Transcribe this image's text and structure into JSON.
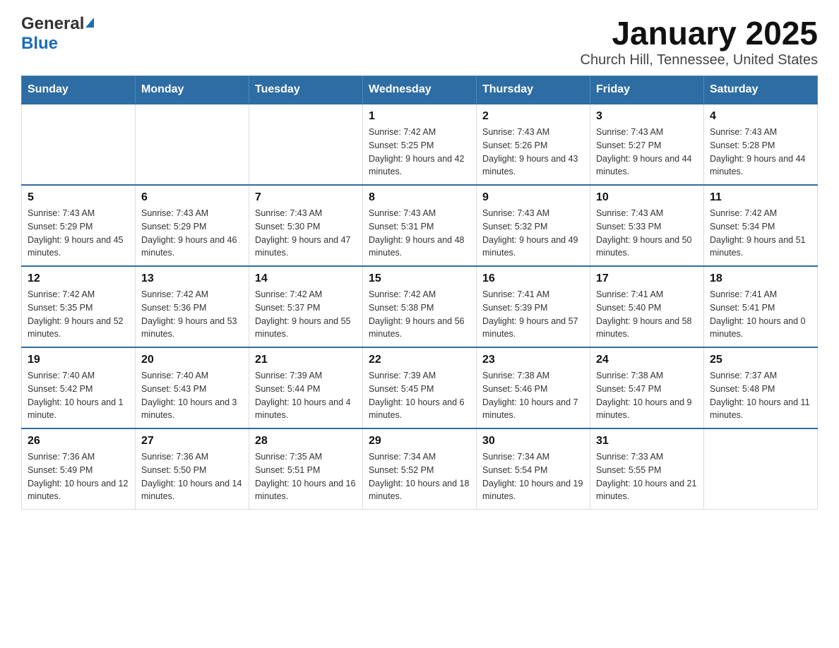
{
  "header": {
    "logo_general": "General",
    "logo_blue": "Blue",
    "title": "January 2025",
    "subtitle": "Church Hill, Tennessee, United States"
  },
  "days_of_week": [
    "Sunday",
    "Monday",
    "Tuesday",
    "Wednesday",
    "Thursday",
    "Friday",
    "Saturday"
  ],
  "weeks": [
    [
      {
        "day": "",
        "info": ""
      },
      {
        "day": "",
        "info": ""
      },
      {
        "day": "",
        "info": ""
      },
      {
        "day": "1",
        "info": "Sunrise: 7:42 AM\nSunset: 5:25 PM\nDaylight: 9 hours and 42 minutes."
      },
      {
        "day": "2",
        "info": "Sunrise: 7:43 AM\nSunset: 5:26 PM\nDaylight: 9 hours and 43 minutes."
      },
      {
        "day": "3",
        "info": "Sunrise: 7:43 AM\nSunset: 5:27 PM\nDaylight: 9 hours and 44 minutes."
      },
      {
        "day": "4",
        "info": "Sunrise: 7:43 AM\nSunset: 5:28 PM\nDaylight: 9 hours and 44 minutes."
      }
    ],
    [
      {
        "day": "5",
        "info": "Sunrise: 7:43 AM\nSunset: 5:29 PM\nDaylight: 9 hours and 45 minutes."
      },
      {
        "day": "6",
        "info": "Sunrise: 7:43 AM\nSunset: 5:29 PM\nDaylight: 9 hours and 46 minutes."
      },
      {
        "day": "7",
        "info": "Sunrise: 7:43 AM\nSunset: 5:30 PM\nDaylight: 9 hours and 47 minutes."
      },
      {
        "day": "8",
        "info": "Sunrise: 7:43 AM\nSunset: 5:31 PM\nDaylight: 9 hours and 48 minutes."
      },
      {
        "day": "9",
        "info": "Sunrise: 7:43 AM\nSunset: 5:32 PM\nDaylight: 9 hours and 49 minutes."
      },
      {
        "day": "10",
        "info": "Sunrise: 7:43 AM\nSunset: 5:33 PM\nDaylight: 9 hours and 50 minutes."
      },
      {
        "day": "11",
        "info": "Sunrise: 7:42 AM\nSunset: 5:34 PM\nDaylight: 9 hours and 51 minutes."
      }
    ],
    [
      {
        "day": "12",
        "info": "Sunrise: 7:42 AM\nSunset: 5:35 PM\nDaylight: 9 hours and 52 minutes."
      },
      {
        "day": "13",
        "info": "Sunrise: 7:42 AM\nSunset: 5:36 PM\nDaylight: 9 hours and 53 minutes."
      },
      {
        "day": "14",
        "info": "Sunrise: 7:42 AM\nSunset: 5:37 PM\nDaylight: 9 hours and 55 minutes."
      },
      {
        "day": "15",
        "info": "Sunrise: 7:42 AM\nSunset: 5:38 PM\nDaylight: 9 hours and 56 minutes."
      },
      {
        "day": "16",
        "info": "Sunrise: 7:41 AM\nSunset: 5:39 PM\nDaylight: 9 hours and 57 minutes."
      },
      {
        "day": "17",
        "info": "Sunrise: 7:41 AM\nSunset: 5:40 PM\nDaylight: 9 hours and 58 minutes."
      },
      {
        "day": "18",
        "info": "Sunrise: 7:41 AM\nSunset: 5:41 PM\nDaylight: 10 hours and 0 minutes."
      }
    ],
    [
      {
        "day": "19",
        "info": "Sunrise: 7:40 AM\nSunset: 5:42 PM\nDaylight: 10 hours and 1 minute."
      },
      {
        "day": "20",
        "info": "Sunrise: 7:40 AM\nSunset: 5:43 PM\nDaylight: 10 hours and 3 minutes."
      },
      {
        "day": "21",
        "info": "Sunrise: 7:39 AM\nSunset: 5:44 PM\nDaylight: 10 hours and 4 minutes."
      },
      {
        "day": "22",
        "info": "Sunrise: 7:39 AM\nSunset: 5:45 PM\nDaylight: 10 hours and 6 minutes."
      },
      {
        "day": "23",
        "info": "Sunrise: 7:38 AM\nSunset: 5:46 PM\nDaylight: 10 hours and 7 minutes."
      },
      {
        "day": "24",
        "info": "Sunrise: 7:38 AM\nSunset: 5:47 PM\nDaylight: 10 hours and 9 minutes."
      },
      {
        "day": "25",
        "info": "Sunrise: 7:37 AM\nSunset: 5:48 PM\nDaylight: 10 hours and 11 minutes."
      }
    ],
    [
      {
        "day": "26",
        "info": "Sunrise: 7:36 AM\nSunset: 5:49 PM\nDaylight: 10 hours and 12 minutes."
      },
      {
        "day": "27",
        "info": "Sunrise: 7:36 AM\nSunset: 5:50 PM\nDaylight: 10 hours and 14 minutes."
      },
      {
        "day": "28",
        "info": "Sunrise: 7:35 AM\nSunset: 5:51 PM\nDaylight: 10 hours and 16 minutes."
      },
      {
        "day": "29",
        "info": "Sunrise: 7:34 AM\nSunset: 5:52 PM\nDaylight: 10 hours and 18 minutes."
      },
      {
        "day": "30",
        "info": "Sunrise: 7:34 AM\nSunset: 5:54 PM\nDaylight: 10 hours and 19 minutes."
      },
      {
        "day": "31",
        "info": "Sunrise: 7:33 AM\nSunset: 5:55 PM\nDaylight: 10 hours and 21 minutes."
      },
      {
        "day": "",
        "info": ""
      }
    ]
  ]
}
